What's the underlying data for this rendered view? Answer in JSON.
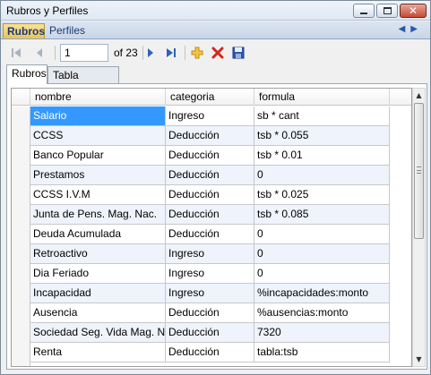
{
  "window": {
    "title": "Rubros y Perfiles"
  },
  "outer_tabs": [
    {
      "label": "Rubros",
      "active": true
    },
    {
      "label": "Perfiles",
      "active": false
    }
  ],
  "navigator": {
    "position": "1",
    "of_label": "of 23"
  },
  "inner_tabs": [
    {
      "label": "Rubros",
      "active": true
    },
    {
      "label": "Tabla Valores",
      "active": false
    }
  ],
  "grid": {
    "columns": [
      "nombre",
      "categoria",
      "formula"
    ],
    "rows": [
      {
        "nombre": "Salario",
        "categoria": "Ingreso",
        "formula": "sb * cant"
      },
      {
        "nombre": "CCSS",
        "categoria": "Deducción",
        "formula": "tsb * 0.055"
      },
      {
        "nombre": "Banco Popular",
        "categoria": "Deducción",
        "formula": "tsb * 0.01"
      },
      {
        "nombre": "Prestamos",
        "categoria": "Deducción",
        "formula": "0"
      },
      {
        "nombre": "CCSS I.V.M",
        "categoria": "Deducción",
        "formula": "tsb * 0.025"
      },
      {
        "nombre": "Junta de Pens. Mag. Nac.",
        "categoria": "Deducción",
        "formula": "tsb * 0.085"
      },
      {
        "nombre": "Deuda Acumulada",
        "categoria": "Deducción",
        "formula": "0"
      },
      {
        "nombre": "Retroactivo",
        "categoria": "Ingreso",
        "formula": "0"
      },
      {
        "nombre": "Dia Feriado",
        "categoria": "Ingreso",
        "formula": "0"
      },
      {
        "nombre": "Incapacidad",
        "categoria": "Ingreso",
        "formula": "%incapacidades:monto"
      },
      {
        "nombre": "Ausencia",
        "categoria": "Deducción",
        "formula": "%ausencias:monto"
      },
      {
        "nombre": "Sociedad Seg. Vida Mag. N...",
        "categoria": "Deducción",
        "formula": "7320"
      },
      {
        "nombre": "Renta",
        "categoria": "Deducción",
        "formula": "tabla:tsb"
      }
    ]
  },
  "colors": {
    "selected": "#3399ff",
    "alt_row": "#eef3fc",
    "accent_tab": "#e9c35a"
  },
  "icons": [
    "minimize-icon",
    "maximize-icon",
    "close-icon",
    "first-record-icon",
    "prev-record-icon",
    "next-record-icon",
    "last-record-icon",
    "add-icon",
    "delete-icon",
    "save-icon"
  ]
}
